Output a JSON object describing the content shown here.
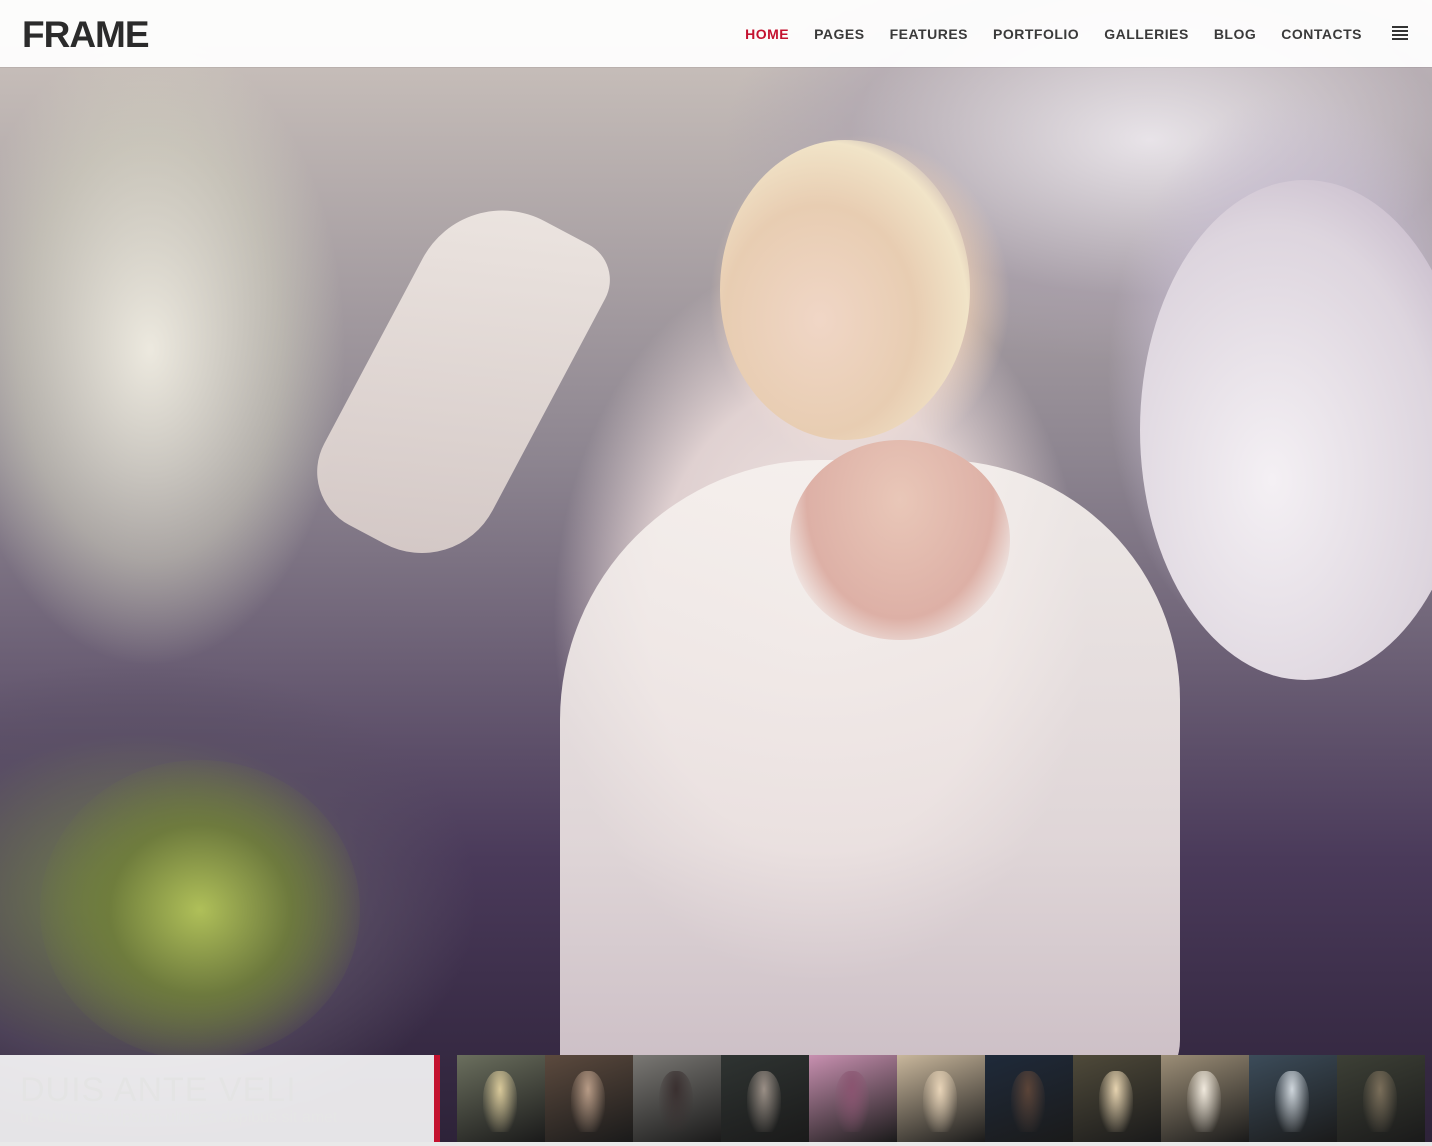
{
  "header": {
    "logo": "FRAME",
    "nav": [
      {
        "label": "HOME",
        "active": true
      },
      {
        "label": "PAGES",
        "active": false
      },
      {
        "label": "FEATURES",
        "active": false
      },
      {
        "label": "PORTFOLIO",
        "active": false
      },
      {
        "label": "GALLERIES",
        "active": false
      },
      {
        "label": "BLOG",
        "active": false
      },
      {
        "label": "CONTACTS",
        "active": false
      }
    ],
    "menu_icon": "hamburger-menu-icon"
  },
  "slide": {
    "title": "DUIS ANTE VELI",
    "subtitle": "ut eu urna eu ipsum ultrices dapibus sit amet"
  },
  "colors": {
    "accent": "#c4122f",
    "header_bg": "#ffffff"
  },
  "thumbnails": [
    {
      "bg": "#6b6f5e",
      "fig": "#d9c99a"
    },
    {
      "bg": "#5c4a3e",
      "fig": "#b79b86"
    },
    {
      "bg": "#7a7874",
      "fig": "#3a3030"
    },
    {
      "bg": "#2f3432",
      "fig": "#9a8f86"
    },
    {
      "bg": "#c890b0",
      "fig": "#8a5470"
    },
    {
      "bg": "#c9b79c",
      "fig": "#e8d4b8"
    },
    {
      "bg": "#1f2a3a",
      "fig": "#5b4438"
    },
    {
      "bg": "#4f4a3a",
      "fig": "#e6d3b0"
    },
    {
      "bg": "#9c8e77",
      "fig": "#f0e9dd"
    },
    {
      "bg": "#3c4c5a",
      "fig": "#cfd6dc"
    },
    {
      "bg": "#3d4036",
      "fig": "#7a6e5a"
    }
  ]
}
